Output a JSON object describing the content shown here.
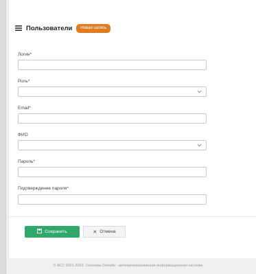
{
  "header": {
    "title": "Пользователи",
    "badge": "Новая запись"
  },
  "form": {
    "fields": [
      {
        "label": "Логин*",
        "value": ""
      },
      {
        "label": "Роль*",
        "value": ""
      },
      {
        "label": "Email*",
        "value": ""
      },
      {
        "label": "ФИО",
        "value": ""
      },
      {
        "label": "Пароль*",
        "value": ""
      },
      {
        "label": "Подтверждение пароля*",
        "value": ""
      }
    ]
  },
  "actions": {
    "save_label": "Сохранить",
    "cancel_label": "Отмена"
  },
  "footer": {
    "text": "© АСУ 2021-2022. Система Онлайн - автоматизированная информационная система"
  },
  "colors": {
    "accent": "#2fa86a",
    "badge": "#e07b22"
  },
  "icons": [
    "menu-icon",
    "chevron-down-icon",
    "save-icon",
    "close-icon"
  ]
}
